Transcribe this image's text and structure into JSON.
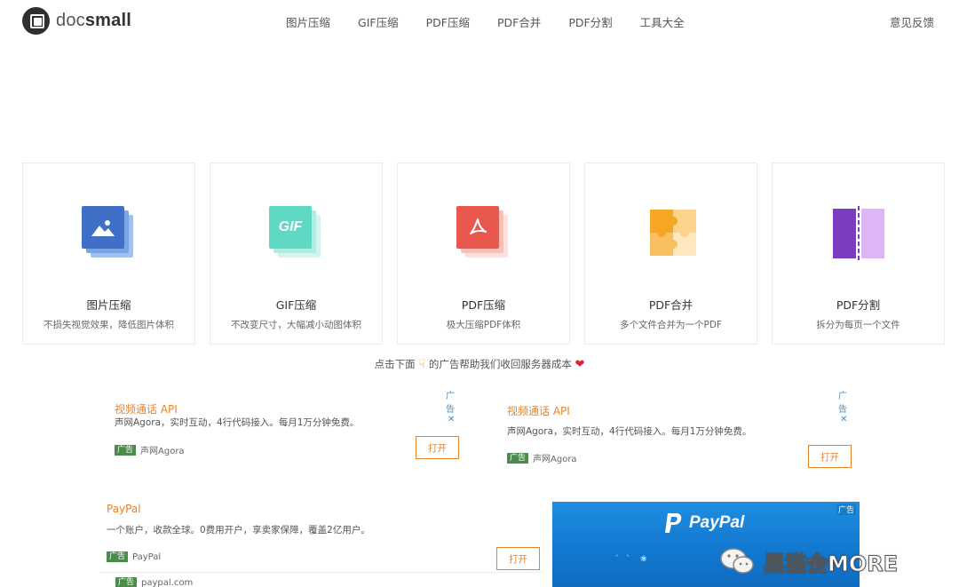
{
  "header": {
    "logo_light": "doc",
    "logo_bold": "small",
    "nav": [
      "图片压缩",
      "GIF压缩",
      "PDF压缩",
      "PDF合并",
      "PDF分割",
      "工具大全"
    ],
    "feedback": "意见反馈"
  },
  "tools": [
    {
      "title": "图片压缩",
      "desc": "不损失视觉效果，降低图片体积",
      "icon": "image-icon",
      "color": "#3f6fc6"
    },
    {
      "title": "GIF压缩",
      "desc": "不改变尺寸，大幅减小动图体积",
      "icon": "gif-icon",
      "color": "#5fd8c4",
      "icon_text": "GIF"
    },
    {
      "title": "PDF压缩",
      "desc": "极大压缩PDF体积",
      "icon": "pdf-icon",
      "color": "#e8584c"
    },
    {
      "title": "PDF合并",
      "desc": "多个文件合并为一个PDF",
      "icon": "puzzle-icon",
      "color": "#f5a623"
    },
    {
      "title": "PDF分割",
      "desc": "拆分为每页一个文件",
      "icon": "split-icon",
      "color": "#7b3cc2"
    }
  ],
  "ad_hint": {
    "before": "点击下面",
    "after": "的广告帮助我们收回服务器成本"
  },
  "ads": [
    {
      "label": "广告",
      "title": "视频通话 API",
      "text": "声网Agora，实时互动，4行代码接入。每月1万分钟免费。",
      "tag": "广告",
      "source": "声网Agora",
      "button": "打开"
    },
    {
      "label": "广告",
      "title": "视频通话 API",
      "text": "声网Agora，实时互动，4行代码接入。每月1万分钟免费。",
      "tag": "广告",
      "source": "声网Agora",
      "button": "打开"
    },
    {
      "title": "PayPal",
      "text": "一个账户，收款全球。0费用开户，享卖家保障，覆盖2亿用户。",
      "tag": "广告",
      "source": "PayPal",
      "button": "打开",
      "tag2": "广告",
      "source2": "paypal.com"
    }
  ],
  "paypal_banner": {
    "word": "PayPal",
    "label": "广告"
  },
  "watermark": {
    "text": "黑猫会MORE"
  },
  "colors": {
    "accent": "#e8832a",
    "ad_tag": "#4b8b4b",
    "ad_label": "#3a8fd8"
  }
}
